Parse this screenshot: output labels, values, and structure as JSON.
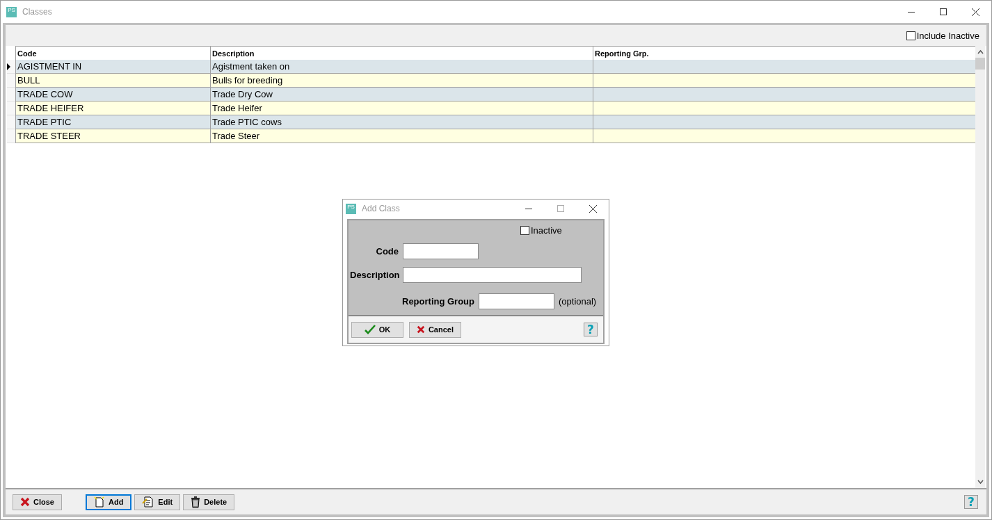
{
  "window": {
    "title": "Classes",
    "app_badge": "PS"
  },
  "toolbar": {
    "include_inactive": {
      "label": "Include Inactive",
      "checked": false
    }
  },
  "table": {
    "columns": [
      "Code",
      "Description",
      "Reporting Grp."
    ],
    "rows": [
      {
        "cells": [
          "AGISTMENT IN",
          "Agistment taken on",
          ""
        ],
        "selected": true
      },
      {
        "cells": [
          "BULL",
          "Bulls for breeding",
          ""
        ],
        "selected": false
      },
      {
        "cells": [
          "TRADE COW",
          "Trade Dry Cow",
          ""
        ],
        "selected": false
      },
      {
        "cells": [
          "TRADE HEIFER",
          "Trade Heifer",
          ""
        ],
        "selected": false
      },
      {
        "cells": [
          "TRADE PTIC",
          "Trade PTIC cows",
          ""
        ],
        "selected": false
      },
      {
        "cells": [
          "TRADE STEER",
          "Trade Steer",
          ""
        ],
        "selected": false
      }
    ]
  },
  "dialog": {
    "title": "Add Class",
    "app_badge": "PS",
    "inactive": {
      "label": "Inactive",
      "checked": false
    },
    "fields": [
      {
        "label": "Code"
      },
      {
        "label": "Description"
      },
      {
        "label": "Reporting Group",
        "note": "(optional)"
      }
    ],
    "buttons": [
      {
        "label": "OK",
        "kind": "ok"
      },
      {
        "label": "Cancel",
        "kind": "cancel"
      }
    ],
    "help": "?"
  },
  "bottom_buttons": [
    {
      "label": "Close",
      "kind": "close",
      "focused": false
    },
    {
      "label": "Add",
      "kind": "add",
      "focused": true
    },
    {
      "label": "Edit",
      "kind": "edit",
      "focused": false
    },
    {
      "label": "Delete",
      "kind": "delete",
      "focused": false
    }
  ],
  "help": "?"
}
